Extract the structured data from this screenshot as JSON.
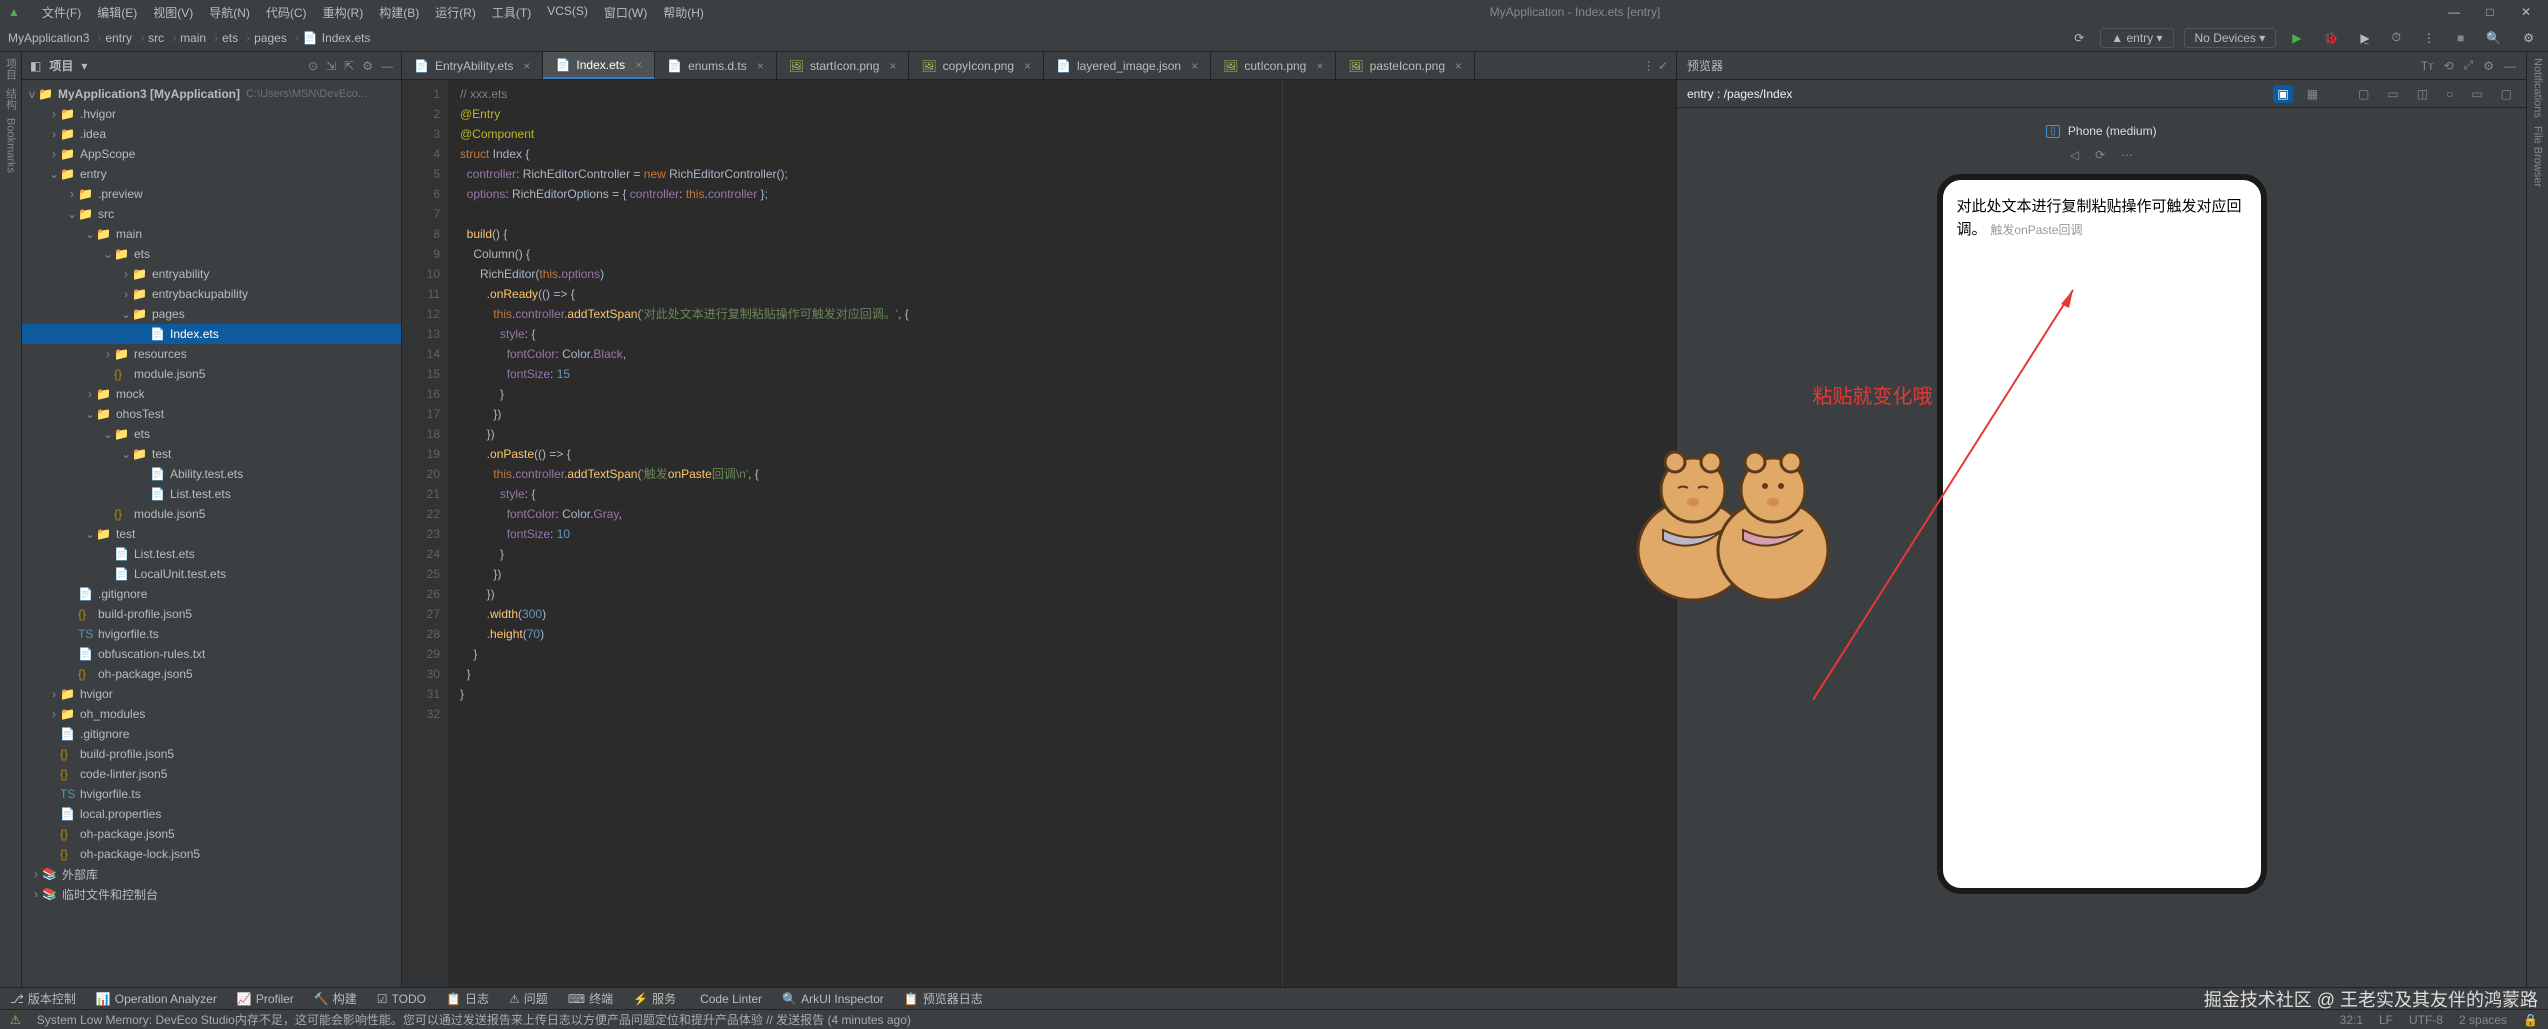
{
  "window_title": "MyApplication - Index.ets [entry]",
  "menubar": [
    "文件(F)",
    "编辑(E)",
    "视图(V)",
    "导航(N)",
    "代码(C)",
    "重构(R)",
    "构建(B)",
    "运行(R)",
    "工具(T)",
    "VCS(S)",
    "窗口(W)",
    "帮助(H)"
  ],
  "breadcrumbs": [
    "MyApplication3",
    "entry",
    "src",
    "main",
    "ets",
    "pages",
    "Index.ets"
  ],
  "run_config": "entry",
  "device_dd": "No Devices",
  "project": {
    "title": "项目",
    "root": "MyApplication3 [MyApplication]",
    "root_hint": "C:\\Users\\MSN\\DevEco...",
    "nodes": [
      {
        "d": 1,
        "t": "folder-hl",
        "a": ">",
        "l": ".hvigor"
      },
      {
        "d": 1,
        "t": "folder",
        "a": ">",
        "l": ".idea"
      },
      {
        "d": 1,
        "t": "folder",
        "a": ">",
        "l": "AppScope"
      },
      {
        "d": 1,
        "t": "folder",
        "a": "v",
        "l": "entry"
      },
      {
        "d": 2,
        "t": "folder-hl",
        "a": ">",
        "l": ".preview"
      },
      {
        "d": 2,
        "t": "folder",
        "a": "v",
        "l": "src"
      },
      {
        "d": 3,
        "t": "folder",
        "a": "v",
        "l": "main"
      },
      {
        "d": 4,
        "t": "folder",
        "a": "v",
        "l": "ets"
      },
      {
        "d": 5,
        "t": "folder",
        "a": ">",
        "l": "entryability"
      },
      {
        "d": 5,
        "t": "folder",
        "a": ">",
        "l": "entrybackupability"
      },
      {
        "d": 5,
        "t": "folder",
        "a": "v",
        "l": "pages"
      },
      {
        "d": 6,
        "t": "file",
        "a": "",
        "l": "Index.ets",
        "sel": true
      },
      {
        "d": 4,
        "t": "folder",
        "a": ">",
        "l": "resources"
      },
      {
        "d": 4,
        "t": "json",
        "a": "",
        "l": "module.json5"
      },
      {
        "d": 3,
        "t": "folder",
        "a": ">",
        "l": "mock"
      },
      {
        "d": 3,
        "t": "folder",
        "a": "v",
        "l": "ohosTest"
      },
      {
        "d": 4,
        "t": "folder",
        "a": "v",
        "l": "ets"
      },
      {
        "d": 5,
        "t": "folder",
        "a": "v",
        "l": "test"
      },
      {
        "d": 6,
        "t": "file",
        "a": "",
        "l": "Ability.test.ets"
      },
      {
        "d": 6,
        "t": "file",
        "a": "",
        "l": "List.test.ets"
      },
      {
        "d": 4,
        "t": "json",
        "a": "",
        "l": "module.json5"
      },
      {
        "d": 3,
        "t": "folder",
        "a": "v",
        "l": "test"
      },
      {
        "d": 4,
        "t": "file",
        "a": "",
        "l": "List.test.ets"
      },
      {
        "d": 4,
        "t": "file",
        "a": "",
        "l": "LocalUnit.test.ets"
      },
      {
        "d": 2,
        "t": "file",
        "a": "",
        "l": ".gitignore"
      },
      {
        "d": 2,
        "t": "json",
        "a": "",
        "l": "build-profile.json5"
      },
      {
        "d": 2,
        "t": "ts",
        "a": "",
        "l": "hvigorfile.ts"
      },
      {
        "d": 2,
        "t": "file",
        "a": "",
        "l": "obfuscation-rules.txt"
      },
      {
        "d": 2,
        "t": "json",
        "a": "",
        "l": "oh-package.json5"
      },
      {
        "d": 1,
        "t": "folder-hl",
        "a": ">",
        "l": "hvigor"
      },
      {
        "d": 1,
        "t": "folder-hl",
        "a": ">",
        "l": "oh_modules"
      },
      {
        "d": 1,
        "t": "file",
        "a": "",
        "l": ".gitignore"
      },
      {
        "d": 1,
        "t": "json",
        "a": "",
        "l": "build-profile.json5"
      },
      {
        "d": 1,
        "t": "json",
        "a": "",
        "l": "code-linter.json5"
      },
      {
        "d": 1,
        "t": "ts",
        "a": "",
        "l": "hvigorfile.ts"
      },
      {
        "d": 1,
        "t": "file",
        "a": "",
        "l": "local.properties"
      },
      {
        "d": 1,
        "t": "json",
        "a": "",
        "l": "oh-package.json5"
      },
      {
        "d": 1,
        "t": "json",
        "a": "",
        "l": "oh-package-lock.json5"
      }
    ],
    "extra": [
      "外部库",
      "临时文件和控制台"
    ]
  },
  "tabs": [
    {
      "l": "EntryAbility.ets",
      "t": "file"
    },
    {
      "l": "Index.ets",
      "t": "file",
      "active": true
    },
    {
      "l": "enums.d.ts",
      "t": "file"
    },
    {
      "l": "startIcon.png",
      "t": "img"
    },
    {
      "l": "copyIcon.png",
      "t": "img"
    },
    {
      "l": "layered_image.json",
      "t": "file"
    },
    {
      "l": "cutIcon.png",
      "t": "img"
    },
    {
      "l": "pasteIcon.png",
      "t": "img"
    }
  ],
  "code_lines": [
    "// xxx.ets",
    "@Entry",
    "@Component",
    "struct Index {",
    "  controller: RichEditorController = new RichEditorController();",
    "  options: RichEditorOptions = { controller: this.controller };",
    "",
    "  build() {",
    "    Column() {",
    "      RichEditor(this.options)",
    "        .onReady(() => {",
    "          this.controller.addTextSpan('对此处文本进行复制粘贴操作可触发对应回调。', {",
    "            style: {",
    "              fontColor: Color.Black,",
    "              fontSize: 15",
    "            }",
    "          })",
    "        })",
    "        .onPaste(() => {",
    "          this.controller.addTextSpan('触发onPaste回调\\n', {",
    "            style: {",
    "              fontColor: Color.Gray,",
    "              fontSize: 10",
    "            }",
    "          })",
    "        })",
    "        .width(300)",
    "        .height(70)",
    "    }",
    "  }",
    "}",
    ""
  ],
  "preview": {
    "title": "预览器",
    "path": "entry : /pages/Index",
    "device": "Phone (medium)",
    "main_text": "对此处文本进行复制粘贴操作可触发对应回调。",
    "hint_text": "触发onPaste回调",
    "annotation": "粘贴就变化哦"
  },
  "bottom_tools": [
    "版本控制",
    "Operation Analyzer",
    "Profiler",
    "构建",
    "TODO",
    "日志",
    "问题",
    "终端",
    "服务",
    "Code Linter",
    "ArkUI Inspector",
    "预览器日志"
  ],
  "brand_text": "掘金技术社区 @ 王老实及其友伴的鸿蒙路",
  "status": {
    "msg": "System Low Memory: DevEco Studio内存不足，这可能会影响性能。您可以通过发送报告来上传日志以方便产品问题定位和提升产品体验 // 发送报告 (4 minutes ago)",
    "pos": "32:1",
    "enc": "LF",
    "charset": "UTF-8",
    "indent": "2 spaces"
  },
  "left_tools": [
    "项目",
    "结构",
    "Bookmarks"
  ],
  "right_tools": [
    "Notifications",
    "File Browser"
  ]
}
